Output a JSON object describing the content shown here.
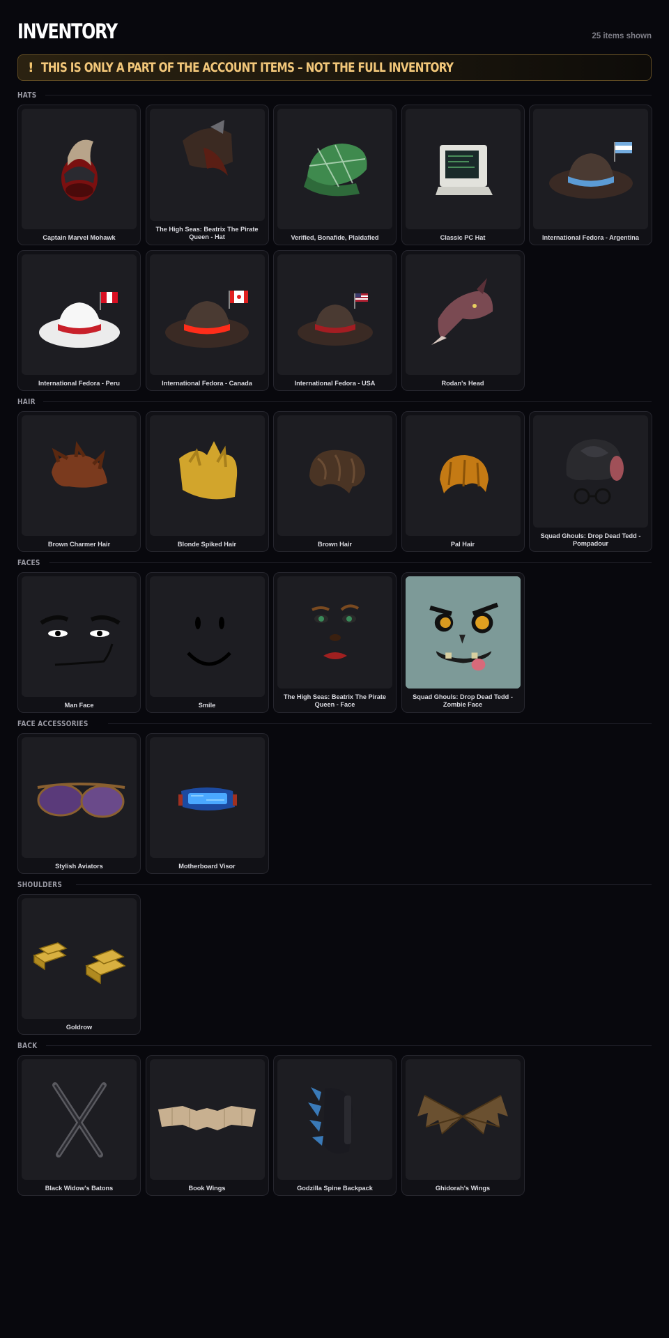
{
  "header": {
    "title": "INVENTORY",
    "count_text": "25 items shown"
  },
  "banner": {
    "icon": "!",
    "text": "THIS IS ONLY A PART OF THE ACCOUNT ITEMS – NOT THE FULL INVENTORY"
  },
  "colors": {
    "background": "#08080d",
    "card": "#111116",
    "thumb": "#1d1d22",
    "banner_accent": "#f2c77a"
  },
  "sections": [
    {
      "label": "HATS",
      "items": [
        {
          "name": "Captain Marvel Mohawk",
          "icon": "mohawk-helmet"
        },
        {
          "name": "The High Seas: Beatrix The Pirate Queen - Hat",
          "icon": "pirate-hat"
        },
        {
          "name": "Verified, Bonafide, Plaidafied",
          "icon": "plaid-cap"
        },
        {
          "name": "Classic PC Hat",
          "icon": "pc-hat"
        },
        {
          "name": "International Fedora - Argentina",
          "icon": "fedora-argentina"
        },
        {
          "name": "International Fedora - Peru",
          "icon": "fedora-peru"
        },
        {
          "name": "International Fedora - Canada",
          "icon": "fedora-canada"
        },
        {
          "name": "International Fedora - USA",
          "icon": "fedora-usa"
        },
        {
          "name": "Rodan's Head",
          "icon": "rodan-head"
        }
      ]
    },
    {
      "label": "HAIR",
      "items": [
        {
          "name": "Brown Charmer Hair",
          "icon": "brown-hair"
        },
        {
          "name": "Blonde Spiked Hair",
          "icon": "blonde-hair"
        },
        {
          "name": "Brown Hair",
          "icon": "brown-hair-2"
        },
        {
          "name": "Pal Hair",
          "icon": "pal-hair"
        },
        {
          "name": "Squad Ghouls: Drop Dead Tedd - Pompadour",
          "icon": "pompadour"
        }
      ]
    },
    {
      "label": "FACES",
      "items": [
        {
          "name": "Man Face",
          "icon": "man-face"
        },
        {
          "name": "Smile",
          "icon": "smile-face"
        },
        {
          "name": "The High Seas: Beatrix The Pirate Queen - Face",
          "icon": "pirate-face"
        },
        {
          "name": "Squad Ghouls: Drop Dead Tedd - Zombie Face",
          "icon": "zombie-face"
        }
      ]
    },
    {
      "label": "FACE ACCESSORIES",
      "items": [
        {
          "name": "Stylish Aviators",
          "icon": "aviators"
        },
        {
          "name": "Motherboard Visor",
          "icon": "visor"
        }
      ]
    },
    {
      "label": "SHOULDERS",
      "items": [
        {
          "name": "Goldrow",
          "icon": "gold-bars"
        }
      ]
    },
    {
      "label": "BACK",
      "items": [
        {
          "name": "Black Widow's Batons",
          "icon": "batons"
        },
        {
          "name": "Book Wings",
          "icon": "book-wings"
        },
        {
          "name": "Godzilla Spine Backpack",
          "icon": "spine-backpack"
        },
        {
          "name": "Ghidorah's Wings",
          "icon": "bat-wings"
        }
      ]
    }
  ]
}
